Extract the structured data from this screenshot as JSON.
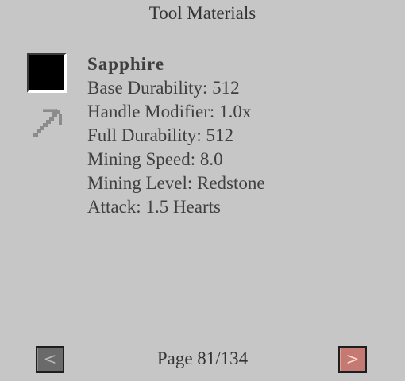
{
  "header": {
    "title": "Tool Materials"
  },
  "material": {
    "name": "Sapphire",
    "swatch_color": "#000000",
    "stats": [
      "Base Durability: 512",
      "Handle Modifier: 1.0x",
      "Full Durability: 512",
      "Mining Speed: 8.0",
      "Mining Level: Redstone",
      "Attack: 1.5 Hearts"
    ],
    "icon": "pickaxe-icon"
  },
  "footer": {
    "prev_label": "<",
    "next_label": ">",
    "page_label": "Page 81/134"
  },
  "colors": {
    "background": "#c6c6c6",
    "text": "#3f3f3f",
    "prev_button": "#6a6a6a",
    "next_button": "#c47a72"
  }
}
